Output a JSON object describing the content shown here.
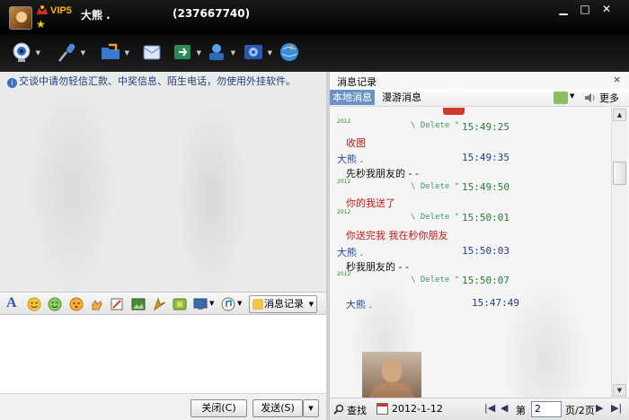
{
  "title": {
    "vip_label": "VIP5",
    "contact_name": "大熊 .",
    "contact_qq": "(237667740)"
  },
  "window_controls": {
    "minimize": "▁",
    "maximize": "□",
    "close": "✕"
  },
  "toolbar": {
    "icons": [
      "camera-icon",
      "microphone-icon",
      "folder-icon",
      "mail-icon",
      "file-transfer-icon",
      "app-icon",
      "settings-icon",
      "globe-icon"
    ]
  },
  "chat": {
    "notice": "交谈中请勿轻信汇款、中奖信息、陌生电话，勿使用外挂软件。",
    "format_icons": [
      "font-icon",
      "smiley-icon",
      "wink-icon",
      "emoji-icon",
      "hand-icon",
      "edit-icon",
      "image-icon",
      "screenshot-icon",
      "puzzle-icon",
      "screen-icon",
      "music-icon"
    ],
    "history_button": "消息记录"
  },
  "send_bar": {
    "close_label": "关闭(C)",
    "send_label": "发送(S)"
  },
  "history": {
    "panel_title": "消息记录",
    "close": "×",
    "tab_local": "本地消息",
    "tab_roam": "漫游消息",
    "more": "更多",
    "messages": [
      {
        "year": "2012",
        "sender": "Delete",
        "time": "15:49:25"
      },
      {
        "text": "收图"
      },
      {
        "sender": "大熊 .",
        "time": "15:49:35"
      },
      {
        "text": "先秒我朋友的 - -"
      },
      {
        "year": "2012",
        "sender": "Delete",
        "time": "15:49:50"
      },
      {
        "text": "你的我送了"
      },
      {
        "year": "2012",
        "sender": "Delete",
        "time": "15:50:01"
      },
      {
        "text": "你送完我 我在秒你朋友"
      },
      {
        "sender": "大熊 .",
        "time": "15:50:03"
      },
      {
        "text": "秒我朋友的 - -"
      },
      {
        "year": "2012",
        "sender": "Delete",
        "time": "15:50:07"
      },
      {
        "sender": "大熊 .",
        "time": "15:47:49"
      }
    ],
    "search_label": "查找",
    "date": "2012-1-12",
    "page_prefix": "第",
    "page_value": "2",
    "page_total": "页/2页"
  }
}
